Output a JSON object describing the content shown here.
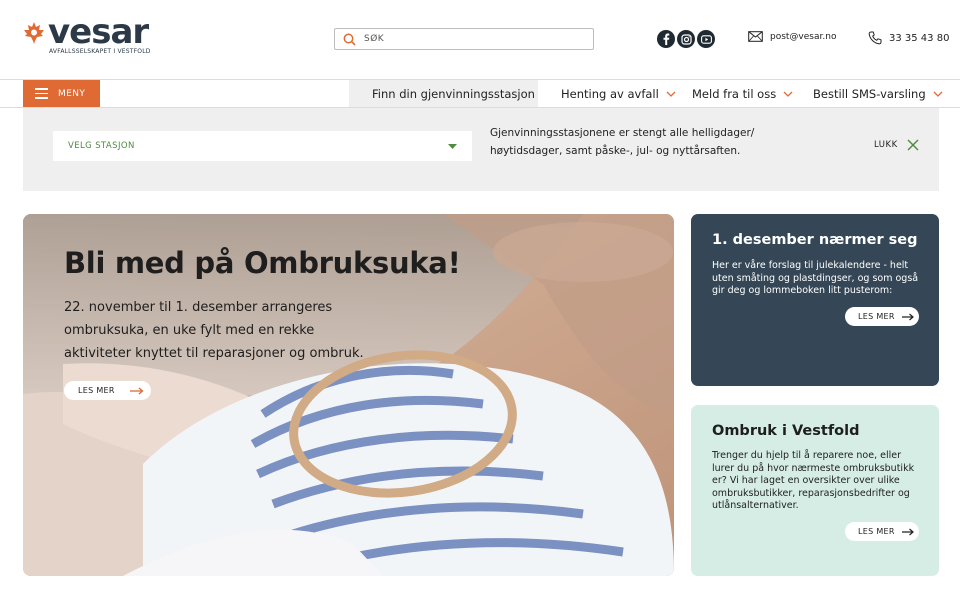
{
  "brand": {
    "name": "vesar",
    "tagline": "AVFALLSSELSKAPET I VESTFOLD",
    "accent": "#e06a34",
    "dark": "#354756",
    "mint": "#d6ede5",
    "green": "#4f8a3f"
  },
  "search": {
    "placeholder": "SØK"
  },
  "social": [
    {
      "icon": "facebook-icon"
    },
    {
      "icon": "instagram-icon"
    },
    {
      "icon": "youtube-icon"
    }
  ],
  "contact": {
    "email": "post@vesar.no",
    "phone": "33 35 43 80"
  },
  "nav": {
    "menu_label": "MENY",
    "items": [
      {
        "label": "Finn din gjenvinningsstasjon"
      },
      {
        "label": "Henting av avfall"
      },
      {
        "label": "Meld fra til oss"
      },
      {
        "label": "Bestill SMS-varsling"
      }
    ]
  },
  "notice": {
    "station_placeholder": "VELG STASJON",
    "text": "Gjenvinningsstasjonene er stengt alle helligdager/ høytidsdager, samt påske-, jul- og nyttårsaften.",
    "close_label": "LUKK"
  },
  "hero": {
    "title": "Bli med på Ombruksuka!",
    "text": "22. november til 1. desember arrangeres ombruksuka, en uke fylt med en rekke aktiviteter knyttet til reparasjoner og ombruk.",
    "cta": "LES MER"
  },
  "cards": [
    {
      "title": "1. desember nærmer seg",
      "text": "Her er våre forslag til julekalendere - helt uten småting og plastdingser, og som også gir deg og lommeboken litt pusterom:",
      "cta": "LES MER"
    },
    {
      "title": "Ombruk i Vestfold",
      "text": "Trenger du hjelp til å reparere noe, eller lurer du på hvor nærmeste ombruksbutikk er? Vi har laget en oversikter over ulike ombruksbutikker, reparasjonsbedrifter og utlånsalternativer.",
      "cta": "LES MER"
    }
  ]
}
